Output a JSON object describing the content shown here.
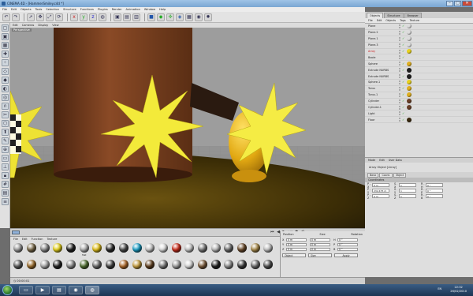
{
  "window": {
    "title": "CINEMA 4D - [HammerSmiley.c4d *]",
    "controls": {
      "min": "–",
      "max": "□",
      "close": "✕"
    }
  },
  "menubar": [
    "File",
    "Edit",
    "Objects",
    "Tools",
    "Selection",
    "Structure",
    "Functions",
    "Plugins",
    "Render",
    "Animation",
    "Window",
    "Help"
  ],
  "toolbar_icons": [
    "undo-icon",
    "redo-icon",
    "live-select-icon",
    "move-icon",
    "scale-icon",
    "rotate-icon",
    "x-axis-icon",
    "y-axis-icon",
    "z-axis-icon",
    "world-icon",
    "render-view-icon",
    "render-picture-icon",
    "render-settings-icon",
    "cube-icon",
    "nurbs-icon",
    "array-icon",
    "deformer-icon",
    "scene-icon",
    "camera-icon",
    "light-icon"
  ],
  "viewport": {
    "menu": [
      "Edit",
      "Cameras",
      "Display",
      "View"
    ],
    "label": "Perspective"
  },
  "materials": {
    "menu": [
      "File",
      "Edit",
      "Function",
      "Texture"
    ],
    "items": [
      {
        "label": "",
        "color": "#9a9a9a"
      },
      {
        "label": "",
        "color": "#7a6a4a"
      },
      {
        "label": "",
        "color": "#8a8a8a"
      },
      {
        "label": "",
        "color": "#e6d21c"
      },
      {
        "label": "",
        "color": "#202020"
      },
      {
        "label": "Mat",
        "color": "#b0b0b0"
      },
      {
        "label": "",
        "color": "#e3c11a"
      },
      {
        "label": "",
        "color": "#2a2a2a"
      },
      {
        "label": "",
        "color": "#4a4a4a"
      },
      {
        "label": "",
        "color": "#1aa0c8"
      },
      {
        "label": "",
        "color": "#c8c8c8"
      },
      {
        "label": "",
        "color": "#dddddd"
      },
      {
        "label": "",
        "color": "#cc2d1b"
      },
      {
        "label": "",
        "color": "#c7c7c7"
      },
      {
        "label": "",
        "color": "#7a7a7a"
      },
      {
        "label": "",
        "color": "#b8b8b8"
      },
      {
        "label": "",
        "color": "#6b6b6b"
      },
      {
        "label": "",
        "color": "#6a4a2a"
      },
      {
        "label": "",
        "color": "#a98b4a"
      },
      {
        "label": "",
        "color": "#c2c2c2"
      },
      {
        "label": "",
        "color": "#5a5a5a"
      },
      {
        "label": "",
        "color": "#9b6d2d"
      },
      {
        "label": "",
        "color": "#a8a8a8"
      },
      {
        "label": "",
        "color": "#222222"
      },
      {
        "label": "",
        "color": "#8a8a8a"
      },
      {
        "label": "",
        "color": "#4f6f2f"
      },
      {
        "label": "",
        "color": "#6a6a6a"
      },
      {
        "label": "",
        "color": "#3f3f3f"
      },
      {
        "label": "",
        "color": "#b06a2a"
      },
      {
        "label": "",
        "color": "#c8a040"
      },
      {
        "label": "",
        "color": "#5f3f1f"
      },
      {
        "label": "",
        "color": "#7a7a7a"
      },
      {
        "label": "",
        "color": "#a0a0a0"
      },
      {
        "label": "",
        "color": "#dadada"
      },
      {
        "label": "",
        "color": "#7a5a3a"
      },
      {
        "label": "",
        "color": "#202020"
      },
      {
        "label": "",
        "color": "#909090"
      },
      {
        "label": "",
        "color": "#3a3a3a"
      },
      {
        "label": "",
        "color": "#6c6c6c"
      },
      {
        "label": "",
        "color": "#505050"
      }
    ]
  },
  "coordinates": {
    "headers": [
      "Position",
      "Size",
      "Rotation"
    ],
    "rows": [
      {
        "axis": "X",
        "pos": "0 m",
        "size": "0 m",
        "rot_axis": "H",
        "rot": "0 °"
      },
      {
        "axis": "Y",
        "pos": "0 m",
        "size": "0 m",
        "rot_axis": "P",
        "rot": "0 °"
      },
      {
        "axis": "Z",
        "pos": "0 m",
        "size": "0 m",
        "rot_axis": "B",
        "rot": "0 °"
      }
    ],
    "mode": "Object",
    "size_mode": "Size",
    "apply": "Apply"
  },
  "objects": {
    "tabs": [
      "Objects",
      "Structure",
      "Browser"
    ],
    "menu": [
      "File",
      "Edit",
      "Objects",
      "Tags",
      "Texture"
    ],
    "rows": [
      {
        "name": "Plane",
        "red": false,
        "tag": "#dcdcdc"
      },
      {
        "name": "Plane.2",
        "red": false,
        "tag": "#dcdcdc"
      },
      {
        "name": "Plane.1",
        "red": false,
        "tag": "#dcdcdc"
      },
      {
        "name": "Plane.3",
        "red": false,
        "tag": "#dcdcdc"
      },
      {
        "name": "Array",
        "red": true,
        "tag": "#e8d21c"
      },
      {
        "name": "Boole",
        "red": false,
        "tag": ""
      },
      {
        "name": "Sphere",
        "red": false,
        "tag": "#e0b020"
      },
      {
        "name": "Extrude NURBS",
        "red": false,
        "tag": "#202020"
      },
      {
        "name": "Extrude NURBS",
        "red": false,
        "tag": "#202020"
      },
      {
        "name": "Sphere.1",
        "red": false,
        "tag": "#e8d21c"
      },
      {
        "name": "Torus",
        "red": false,
        "tag": "#e0b020"
      },
      {
        "name": "Torus.1",
        "red": false,
        "tag": "#e0b020"
      },
      {
        "name": "Cylinder",
        "red": false,
        "tag": "#6a4028"
      },
      {
        "name": "Cylinder.1",
        "red": false,
        "tag": "#6a4028"
      },
      {
        "name": "Light",
        "red": false,
        "tag": ""
      },
      {
        "name": "Floor",
        "red": false,
        "tag": "#3a2a10"
      }
    ]
  },
  "attributes": {
    "menu": [
      "Mode",
      "Edit",
      "User Data"
    ],
    "title": "Array Object [Array]",
    "tabs": [
      "Basic",
      "Coord.",
      "Object"
    ],
    "section": "Coordinates",
    "rows": [
      {
        "a": "P . X",
        "v1": "0 m",
        "b": "S . X",
        "v2": "1",
        "c": "R . H",
        "v3": "0 °"
      },
      {
        "a": "P . Y",
        "v1": "232.475 m",
        "b": "S . Y",
        "v2": "1",
        "c": "R . P",
        "v3": "0 °"
      },
      {
        "a": "P . Z",
        "v1": "0 m",
        "b": "S . Z",
        "v2": "1",
        "c": "R . B",
        "v3": "0 °"
      }
    ]
  },
  "status": {
    "time": "00:00:01"
  },
  "taskbar": {
    "clock_time": "22:32",
    "clock_date": "26/02/2010",
    "tray": "EN"
  }
}
